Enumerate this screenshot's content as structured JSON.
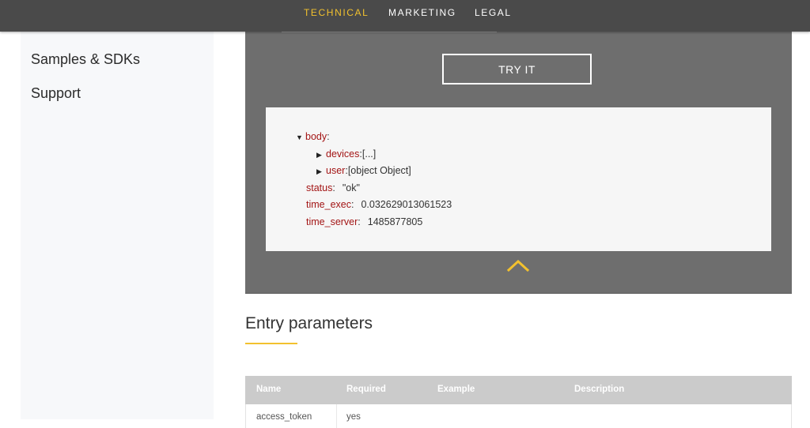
{
  "topnav": {
    "items": [
      {
        "label": "TECHNICAL",
        "active": true
      },
      {
        "label": "MARKETING",
        "active": false
      },
      {
        "label": "LEGAL",
        "active": false
      }
    ]
  },
  "sidebar": {
    "items": [
      {
        "label": "Samples & SDKs"
      },
      {
        "label": "Support"
      }
    ]
  },
  "try_it": {
    "button_label": "TRY IT"
  },
  "response": {
    "body_key": "body",
    "devices_key": "devices",
    "devices_value": "[...]",
    "user_key": "user",
    "user_value": "[object Object]",
    "status_key": "status",
    "status_value": "\"ok\"",
    "time_exec_key": "time_exec",
    "time_exec_value": "0.032629013061523",
    "time_server_key": "time_server",
    "time_server_value": "1485877805",
    "separator": ":"
  },
  "entry_parameters": {
    "title": "Entry parameters",
    "columns": [
      "Name",
      "Required",
      "Example",
      "Description"
    ],
    "rows": [
      {
        "name": "access_token",
        "required": "yes"
      }
    ]
  },
  "colors": {
    "accent": "#f2c12e",
    "nav_bg": "#4a4a4a",
    "panel_bg": "#6e6e6e",
    "json_key": "#a31515"
  }
}
